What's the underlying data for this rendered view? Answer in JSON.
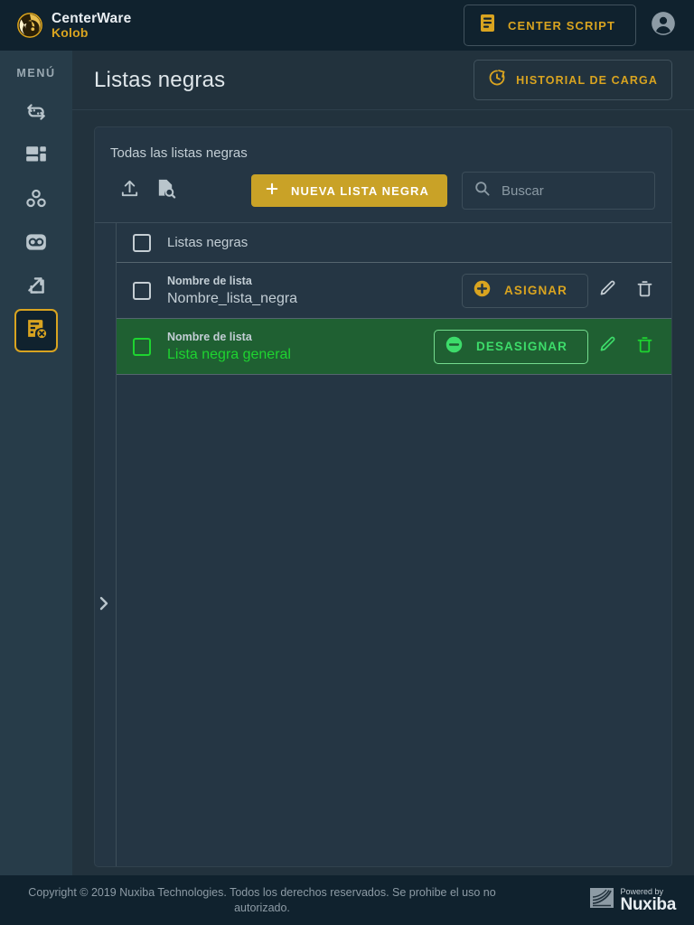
{
  "topbar": {
    "brand_title": "CenterWare",
    "brand_sub": "Kolob",
    "brand_icon": "centerware-logo-icon",
    "center_script_label": "CENTER SCRIPT",
    "center_script_icon": "server-document-icon",
    "account_icon": "account-circle-icon"
  },
  "sidebar": {
    "menu_label": "MENÚ",
    "items": [
      {
        "name": "sidebar-item-campaign-recycle",
        "icon": "recycle-contacts-icon",
        "active": false
      },
      {
        "name": "sidebar-item-dashboard",
        "icon": "dashboard-grid-icon",
        "active": false
      },
      {
        "name": "sidebar-item-groups",
        "icon": "bubble-chart-icon",
        "active": false
      },
      {
        "name": "sidebar-item-voicemail",
        "icon": "voicemail-icon",
        "active": false
      },
      {
        "name": "sidebar-item-transfers",
        "icon": "compare-arrows-icon",
        "active": false
      },
      {
        "name": "sidebar-item-blacklists",
        "icon": "list-remove-icon",
        "active": true
      }
    ],
    "expander_icon": "chevron-right-icon"
  },
  "page": {
    "title": "Listas negras",
    "history_button_label": "HISTORIAL DE CARGA",
    "history_button_icon": "history-clock-icon"
  },
  "card": {
    "title": "Todas las listas negras",
    "toolbar": {
      "upload_icon": "upload-icon",
      "upload_name": "upload-blacklist-button",
      "preview_icon": "document-search-icon",
      "preview_name": "preview-blacklist-button",
      "new_button_label": "NUEVA LISTA NEGRA",
      "new_button_icon": "plus-icon",
      "search_placeholder": "Buscar",
      "search_value": "",
      "search_icon": "search-icon"
    },
    "table": {
      "header_label": "Listas negras",
      "header_checkbox_name": "select-all-checkbox",
      "rows": [
        {
          "field_label": "Nombre de lista",
          "value": "Nombre_lista_negra",
          "action_label": "ASIGNAR",
          "action_icon": "plus-circle-icon",
          "edit_icon": "pencil-icon",
          "delete_icon": "trash-icon",
          "selected": false
        },
        {
          "field_label": "Nombre de lista",
          "value": "Lista negra general",
          "action_label": "DESASIGNAR",
          "action_icon": "minus-circle-icon",
          "edit_icon": "pencil-icon",
          "delete_icon": "trash-icon",
          "selected": true
        }
      ]
    }
  },
  "footer": {
    "copyright": "Copyright © 2019 Nuxiba Technologies. Todos los derechos reservados. Se prohibe el uso no autorizado.",
    "powered_by_top": "Powered by",
    "powered_by_name": "Nuxiba",
    "powered_by_icon": "nuxiba-logo-icon"
  },
  "colors": {
    "page_bg": "#10222e",
    "content_bg": "#22323d",
    "card_bg": "#253644",
    "sidebar_bg": "#273c49",
    "accent_gold": "#d9a420",
    "button_gold": "#c9a227",
    "selected_green_bg": "#1f6032",
    "selected_green_fg": "#1ed430"
  }
}
